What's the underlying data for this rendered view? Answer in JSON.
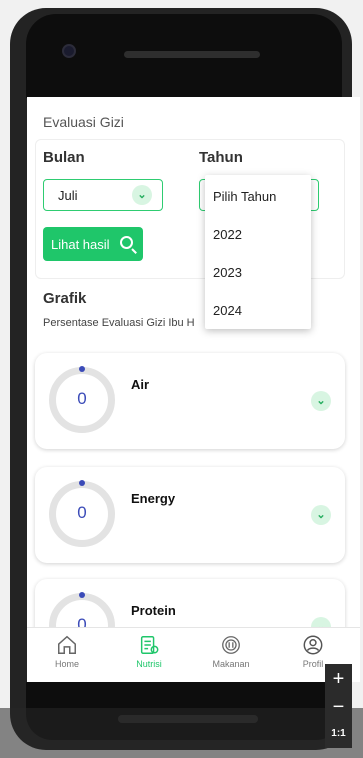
{
  "section_title": "Evaluasi Gizi",
  "filter": {
    "month_label": "Bulan",
    "month_value": "Juli",
    "year_label": "Tahun",
    "search_button": "Lihat hasil"
  },
  "year_dropdown": {
    "options": [
      "Pilih Tahun",
      "2022",
      "2023",
      "2024"
    ]
  },
  "grafik": {
    "title": "Grafik",
    "subtitle": "Persentase Evaluasi Gizi Ibu H"
  },
  "nutrients": [
    {
      "name": "Air",
      "value": "0"
    },
    {
      "name": "Energy",
      "value": "0"
    },
    {
      "name": "Protein",
      "value": "0"
    }
  ],
  "bottom_nav": [
    {
      "label": "Home",
      "icon": "home-icon"
    },
    {
      "label": "Nutrisi",
      "icon": "clipboard-icon",
      "active": true
    },
    {
      "label": "Makanan",
      "icon": "food-icon"
    },
    {
      "label": "Profil",
      "icon": "profile-icon"
    }
  ],
  "emulator": {
    "zoom_in": "+",
    "zoom_out": "−",
    "zoom_ratio": "1:1"
  },
  "colors": {
    "accent_green": "#1fc66a",
    "ring_blue": "#3b4bb8"
  }
}
